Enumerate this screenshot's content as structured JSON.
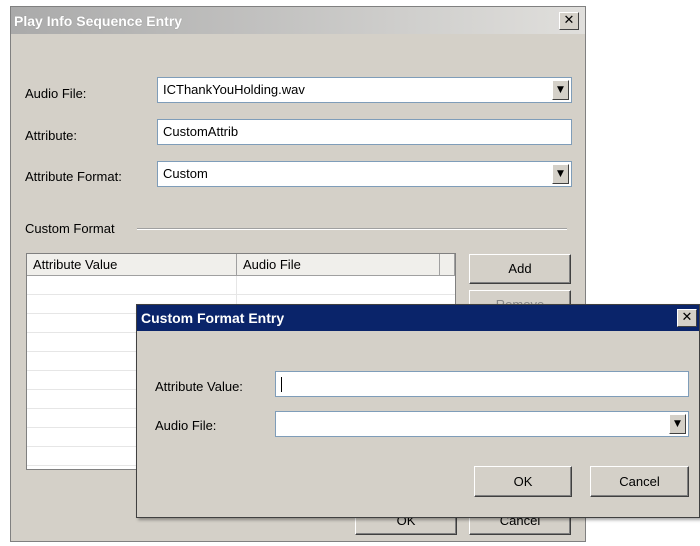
{
  "main_dialog": {
    "title": "Play Info Sequence Entry",
    "close_glyph": "✕",
    "audio_file_label": "Audio File:",
    "audio_file_value": "ICThankYouHolding.wav",
    "attribute_label": "Attribute:",
    "attribute_value": "CustomAttrib",
    "attribute_format_label": "Attribute Format:",
    "attribute_format_value": "Custom",
    "dropdown_glyph": "▼",
    "custom_format_group": "Custom Format",
    "list_columns": [
      "Attribute Value",
      "Audio File"
    ],
    "add_button": "Add",
    "remove_button": "Remove",
    "ok_button": "OK",
    "cancel_button": "Cancel"
  },
  "custom_format_dialog": {
    "title": "Custom Format Entry",
    "close_glyph": "✕",
    "attribute_value_label": "Attribute Value:",
    "attribute_value": "",
    "audio_file_label": "Audio File:",
    "audio_file_value": "",
    "dropdown_glyph": "▼",
    "ok_button": "OK",
    "cancel_button": "Cancel"
  }
}
